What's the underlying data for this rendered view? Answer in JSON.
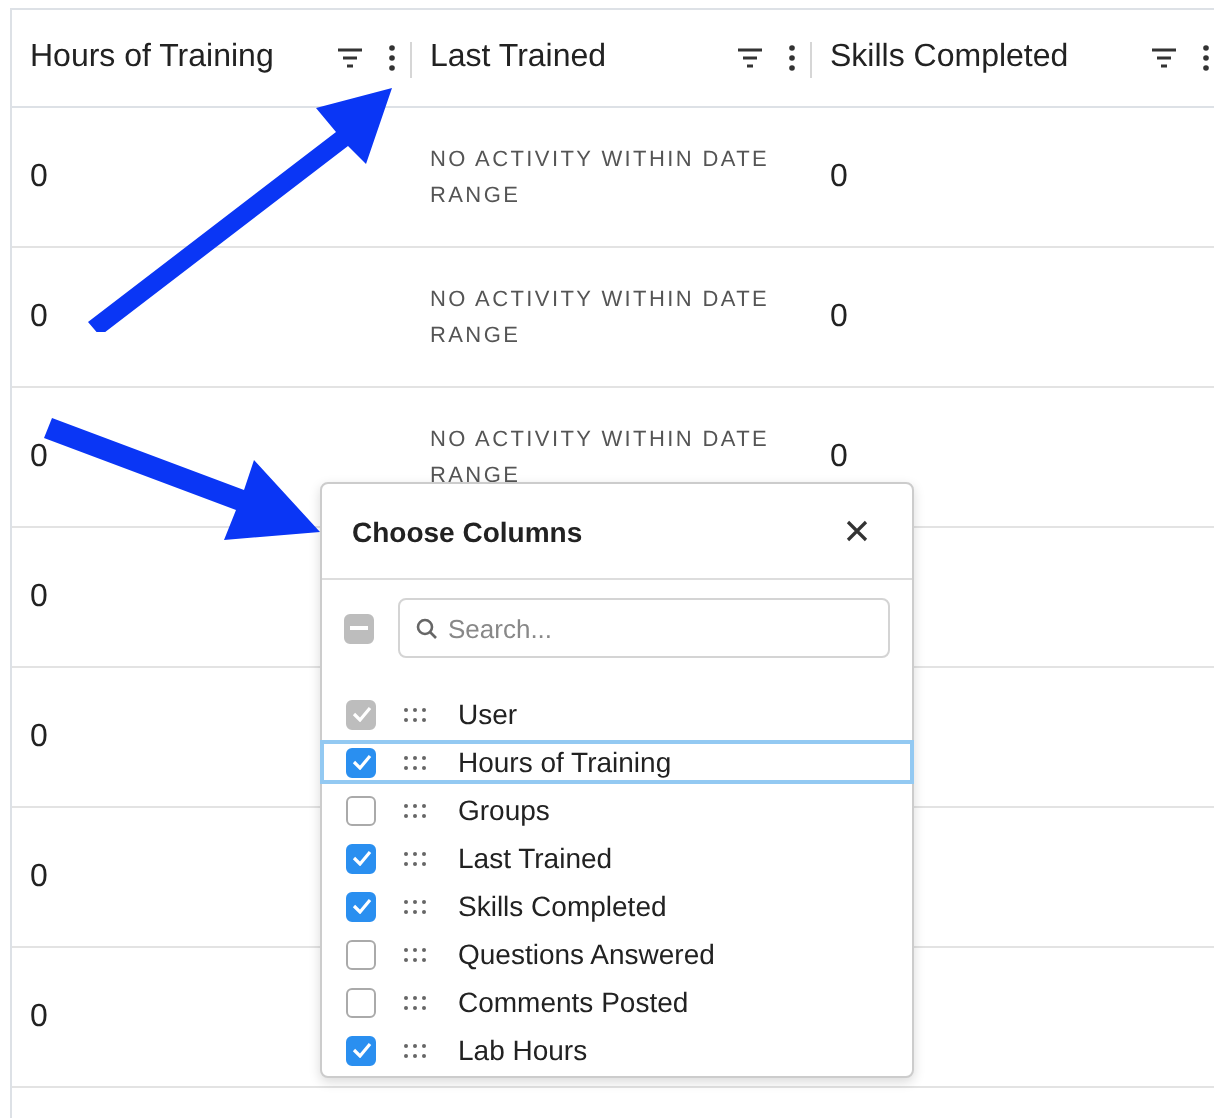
{
  "table": {
    "columns": [
      {
        "label": "Hours of Training"
      },
      {
        "label": "Last Trained"
      },
      {
        "label": "Skills Completed"
      }
    ],
    "rows": [
      {
        "cells": [
          "0",
          "NO ACTIVITY WITHIN DATE RANGE",
          "0"
        ]
      },
      {
        "cells": [
          "0",
          "NO ACTIVITY WITHIN DATE RANGE",
          "0"
        ]
      },
      {
        "cells": [
          "0",
          "NO ACTIVITY WITHIN DATE RANGE",
          "0"
        ]
      },
      {
        "cells": [
          "0"
        ]
      },
      {
        "cells": [
          "0"
        ]
      },
      {
        "cells": [
          "0"
        ]
      },
      {
        "cells": [
          "0"
        ]
      }
    ]
  },
  "column_chooser": {
    "title": "Choose Columns",
    "select_all": {
      "indeterminate": true
    },
    "search": {
      "placeholder": "Search..."
    },
    "items": [
      {
        "label": "User",
        "checked": true,
        "disabled": true,
        "selected": false
      },
      {
        "label": "Hours of Training",
        "checked": true,
        "disabled": false,
        "selected": true
      },
      {
        "label": "Groups",
        "checked": false,
        "disabled": false,
        "selected": false
      },
      {
        "label": "Last Trained",
        "checked": true,
        "disabled": false,
        "selected": false
      },
      {
        "label": "Skills Completed",
        "checked": true,
        "disabled": false,
        "selected": false
      },
      {
        "label": "Questions Answered",
        "checked": false,
        "disabled": false,
        "selected": false
      },
      {
        "label": "Comments Posted",
        "checked": false,
        "disabled": false,
        "selected": false
      },
      {
        "label": "Lab Hours",
        "checked": true,
        "disabled": false,
        "selected": false
      }
    ]
  },
  "annotations": [
    {
      "kind": "arrow"
    },
    {
      "kind": "arrow"
    }
  ]
}
